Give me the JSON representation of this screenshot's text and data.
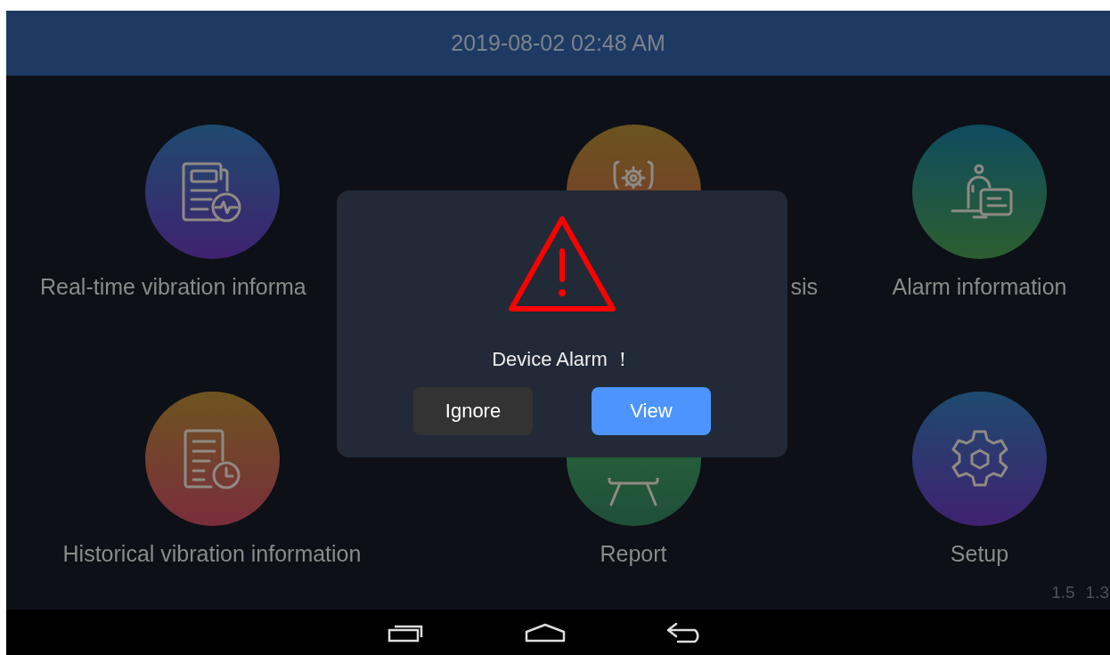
{
  "status_bar": {
    "datetime": "2019-08-02 02:48 AM"
  },
  "tiles": [
    {
      "kind": "realtime",
      "label": "Real-time vibration informa"
    },
    {
      "kind": "diagnosis",
      "label": "sis"
    },
    {
      "kind": "alarm",
      "label": "Alarm information"
    },
    {
      "kind": "history",
      "label": "Historical vibration information"
    },
    {
      "kind": "report",
      "label": "Report"
    },
    {
      "kind": "setup",
      "label": "Setup"
    }
  ],
  "versions": [
    "1.5",
    "1.3"
  ],
  "dialog": {
    "message": "Device Alarm ！",
    "buttons": [
      {
        "label": "Ignore",
        "kind": "secondary"
      },
      {
        "label": "View",
        "kind": "primary"
      }
    ]
  },
  "nav_bar": {
    "buttons": [
      {
        "kind": "recents"
      },
      {
        "kind": "home"
      },
      {
        "kind": "back"
      }
    ]
  }
}
